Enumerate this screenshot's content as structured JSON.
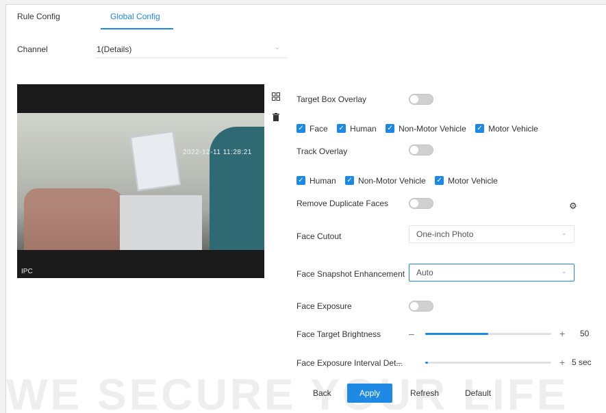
{
  "tabs": [
    {
      "label": "Rule Config"
    },
    {
      "label": "Global Config"
    }
  ],
  "channel": {
    "label": "Channel",
    "value": "1(Details)"
  },
  "video": {
    "timestamp": "2022-12-11 11:28:21",
    "osd_label": "IPC"
  },
  "settings": {
    "target_box_overlay": {
      "label": "Target Box Overlay",
      "enabled": false
    },
    "target_box_types": [
      "Face",
      "Human",
      "Non-Motor Vehicle",
      "Motor Vehicle"
    ],
    "track_overlay": {
      "label": "Track Overlay",
      "enabled": false
    },
    "track_types": [
      "Human",
      "Non-Motor Vehicle",
      "Motor Vehicle"
    ],
    "remove_duplicate_faces": {
      "label": "Remove Duplicate Faces",
      "enabled": false
    },
    "face_cutout": {
      "label": "Face Cutout",
      "value": "One-inch Photo"
    },
    "face_snapshot_enhancement": {
      "label": "Face Snapshot Enhancement",
      "value": "Auto"
    },
    "face_exposure": {
      "label": "Face Exposure",
      "enabled": false
    },
    "face_target_brightness": {
      "label": "Face Target Brightness",
      "value": "50",
      "level": 0.5
    },
    "face_exposure_interval": {
      "label": "Face Exposure Interval Det...",
      "value": "5 sec",
      "level": 0.02
    }
  },
  "buttons": {
    "back": "Back",
    "apply": "Apply",
    "refresh": "Refresh",
    "default": "Default"
  },
  "slider_symbols": {
    "minus": "–",
    "plus": "+"
  },
  "watermark": "WE SECURE YOUR LIFE",
  "colors": {
    "accent": "#1e88e5",
    "toggle_off": "#d0d0d0"
  },
  "icons": [
    "grid-icon",
    "trash-icon",
    "chevron-down-icon",
    "gear-icon",
    "checkmark-icon"
  ]
}
